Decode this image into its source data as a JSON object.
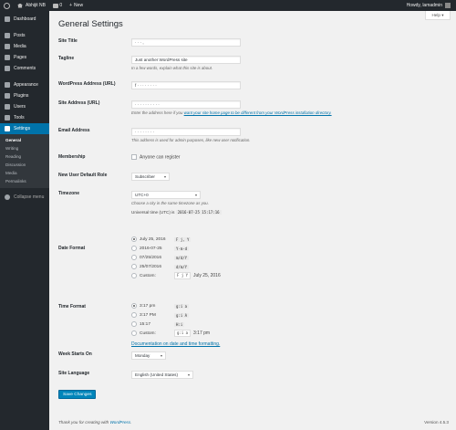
{
  "adminbar": {
    "site_name": "Abhijit NB",
    "comment_count": "0",
    "new_label": "New",
    "greeting": "Howdy, lamadmin"
  },
  "sidebar": {
    "items": [
      {
        "label": "Dashboard",
        "icon": "dashboard-icon"
      },
      {
        "label": "Posts",
        "icon": "pin-icon"
      },
      {
        "label": "Media",
        "icon": "media-icon"
      },
      {
        "label": "Pages",
        "icon": "pages-icon"
      },
      {
        "label": "Comments",
        "icon": "comments-icon"
      },
      {
        "label": "Appearance",
        "icon": "brush-icon"
      },
      {
        "label": "Plugins",
        "icon": "plug-icon"
      },
      {
        "label": "Users",
        "icon": "users-icon"
      },
      {
        "label": "Tools",
        "icon": "wrench-icon"
      },
      {
        "label": "Settings",
        "icon": "settings-icon"
      }
    ],
    "submenu": [
      "General",
      "Writing",
      "Reading",
      "Discussion",
      "Media",
      "Permalinks"
    ],
    "collapse_label": "Collapse menu"
  },
  "help_label": "Help ▾",
  "page_title": "General Settings",
  "fields": {
    "site_title": {
      "label": "Site Title",
      "value": "· · · ,"
    },
    "tagline": {
      "label": "Tagline",
      "value": "Just another WordPress site",
      "desc": "In a few words, explain what this site is about."
    },
    "wp_address": {
      "label": "WordPress Address (URL)",
      "value": "f · · · · · · · ·"
    },
    "site_address": {
      "label": "Site Address (URL)",
      "value": "· · · · · · · · · ·",
      "desc_before": "Enter the address here if you ",
      "desc_link": "want your site home page to be different from your WordPress installation directory."
    },
    "email": {
      "label": "Email Address",
      "value": "· · · · · · · ·",
      "desc": "This address is used for admin purposes, like new user notification."
    },
    "membership": {
      "label": "Membership",
      "checkbox_label": "Anyone can register"
    },
    "default_role": {
      "label": "New User Default Role",
      "value": "Subscriber"
    },
    "timezone": {
      "label": "Timezone",
      "value": "UTC+0",
      "desc": "Choose a city in the same timezone as you.",
      "utc_label": "Universal time (UTC) is",
      "utc_value": "2016-07-25 15:17:16"
    },
    "date_format": {
      "label": "Date Format",
      "options": [
        {
          "text": "July 25, 2016",
          "code": "F j, Y",
          "checked": true
        },
        {
          "text": "2016-07-25",
          "code": "Y-m-d",
          "checked": false
        },
        {
          "text": "07/25/2016",
          "code": "m/d/Y",
          "checked": false
        },
        {
          "text": "25/07/2016",
          "code": "d/m/Y",
          "checked": false
        }
      ],
      "custom_label": "Custom:",
      "custom_value": "F j Y",
      "custom_preview": "July 25, 2016"
    },
    "time_format": {
      "label": "Time Format",
      "options": [
        {
          "text": "3:17 pm",
          "code": "g:i a",
          "checked": true
        },
        {
          "text": "3:17 PM",
          "code": "g:i A",
          "checked": false
        },
        {
          "text": "15:17",
          "code": "H:i",
          "checked": false
        }
      ],
      "custom_label": "Custom:",
      "custom_value": "g:i a",
      "custom_preview": "3:17 pm",
      "doc_link": "Documentation on date and time formatting."
    },
    "week_starts": {
      "label": "Week Starts On",
      "value": "Monday"
    },
    "language": {
      "label": "Site Language",
      "value": "English (United States)"
    }
  },
  "save_label": "Save Changes",
  "footer": {
    "thanks_before": "Thank you for creating with ",
    "thanks_link": "WordPress",
    "thanks_after": ".",
    "version": "Version 4.5.3"
  },
  "colors": {
    "adminbar": "#23282d",
    "accent": "#0073aa",
    "button": "#0085ba"
  }
}
